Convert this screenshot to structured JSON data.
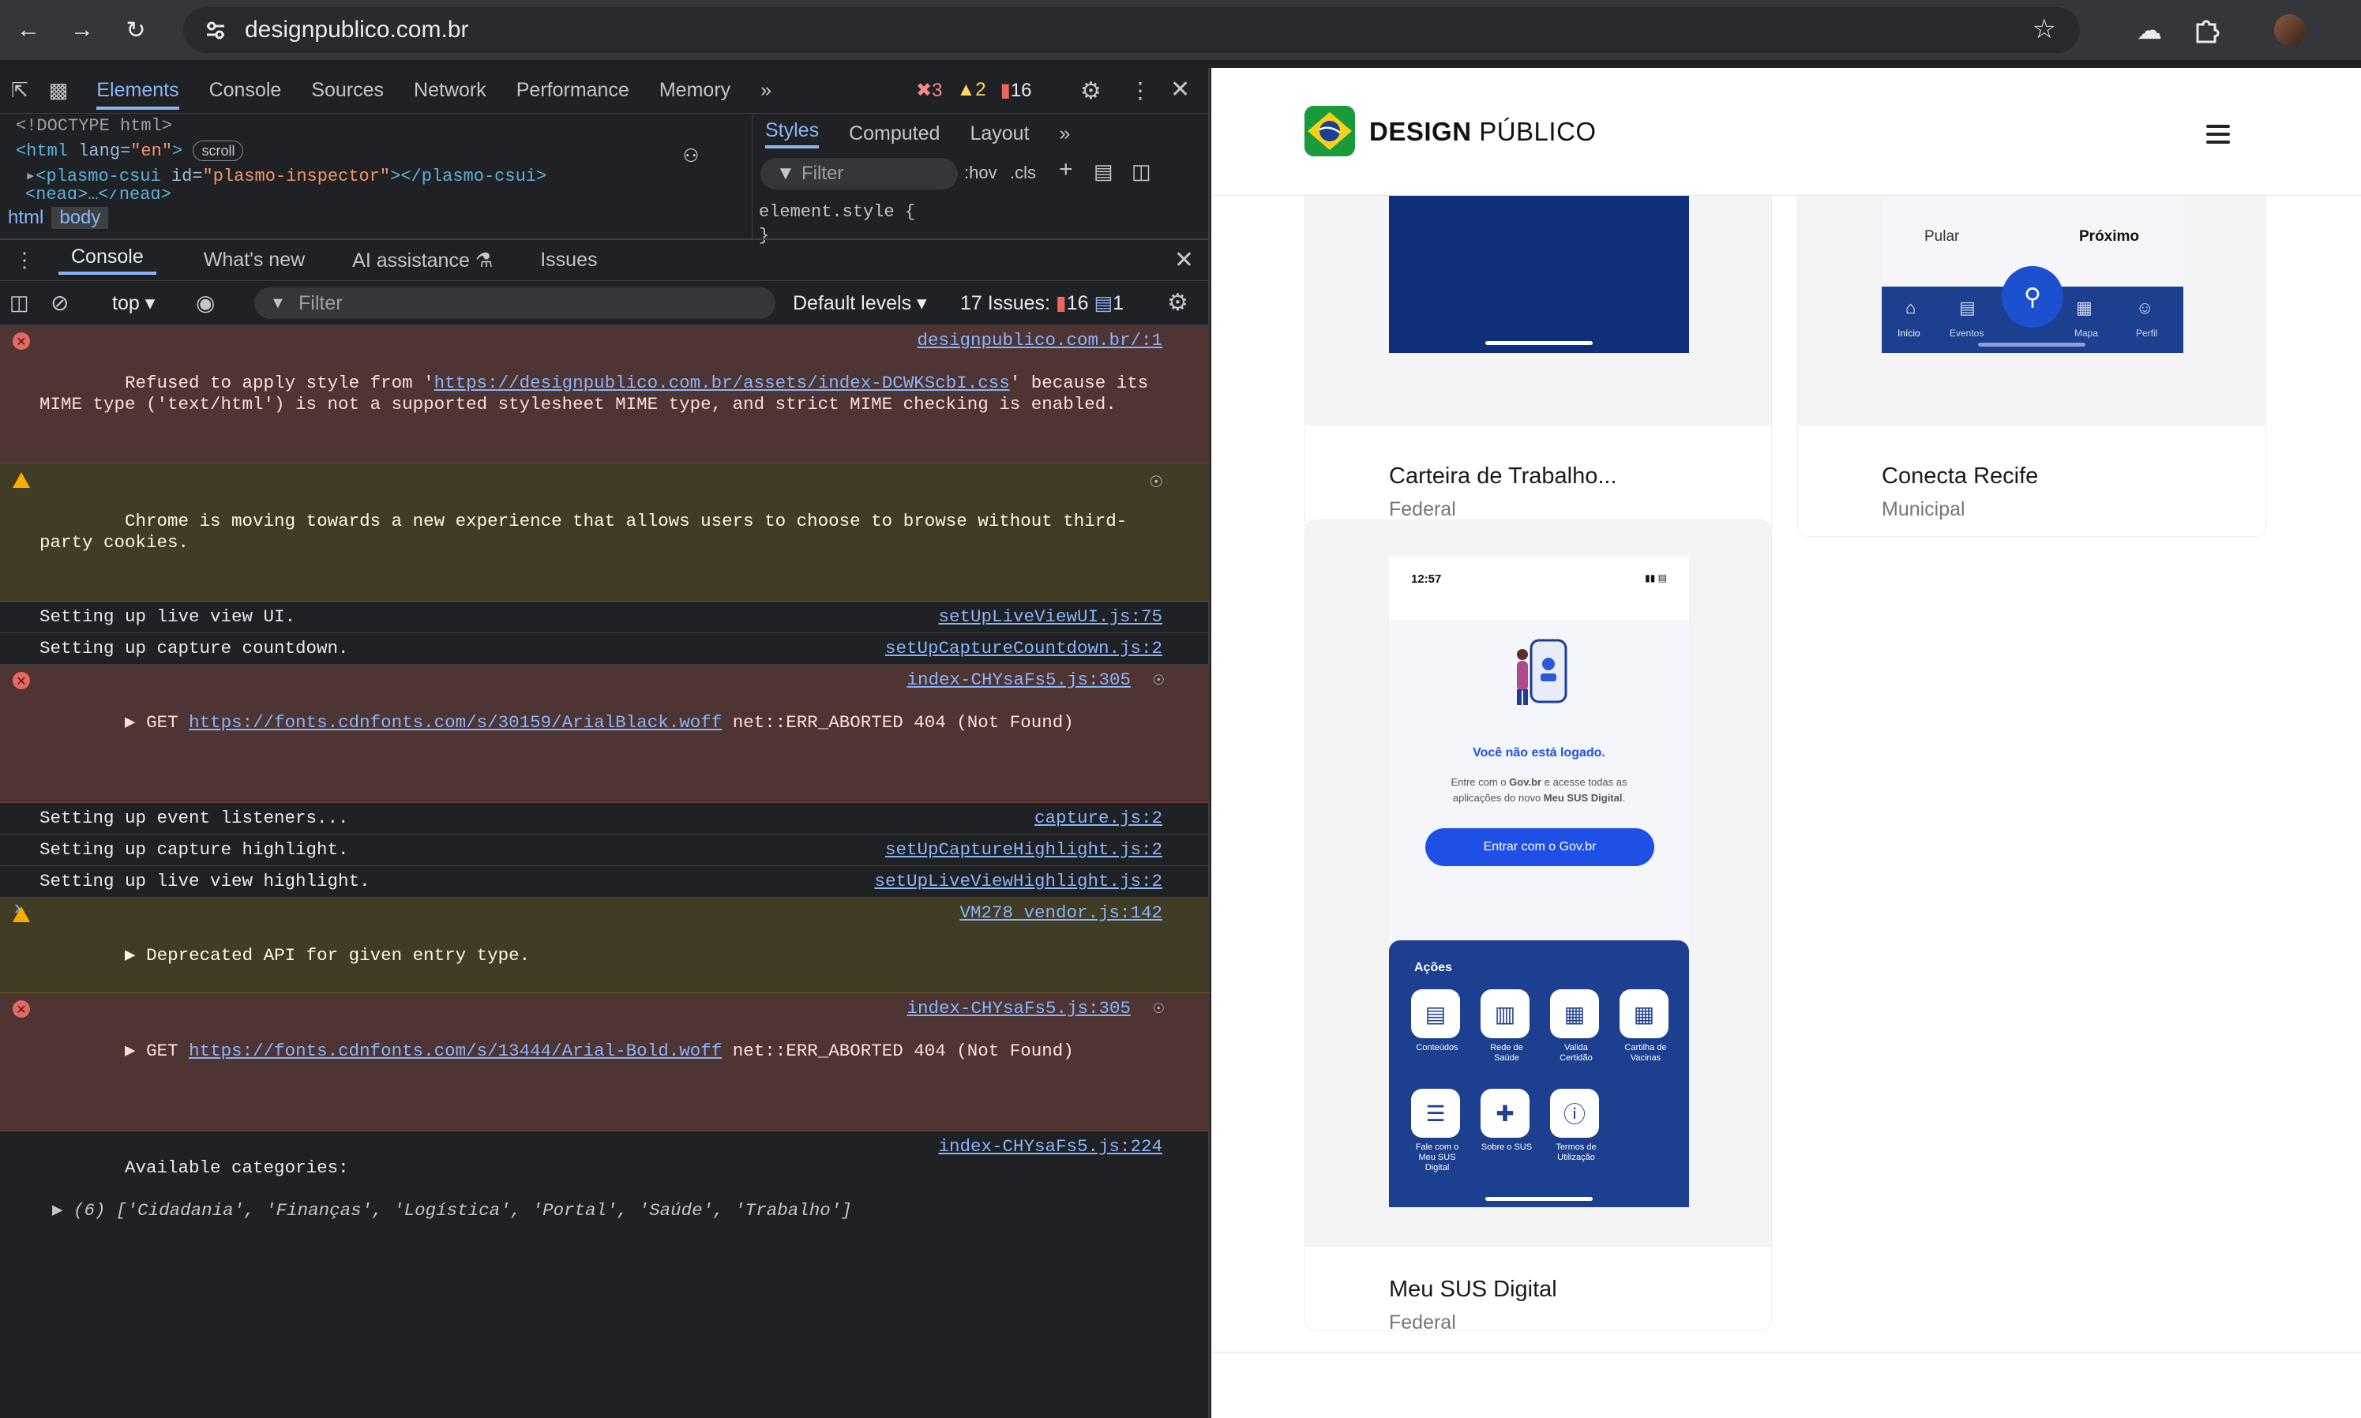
{
  "browser": {
    "url": "designpublico.com.br",
    "back_icon": "arrow-left-icon",
    "forward_icon": "arrow-right-icon",
    "reload_icon": "reload-icon"
  },
  "devtools": {
    "tabs": [
      "Elements",
      "Console",
      "Sources",
      "Network",
      "Performance",
      "Memory"
    ],
    "more": "»",
    "counts": {
      "errors": "3",
      "warnings": "2",
      "issues": "16"
    },
    "elements": {
      "doctype": "<!DOCTYPE html>",
      "html_open": "<html",
      "html_attr": " lang=",
      "html_val": "\"en\"",
      "html_close": ">",
      "scroll": "scroll",
      "csui_open": "<plasmo-csui",
      "csui_attr": " id=",
      "csui_val": "\"plasmo-inspector\"",
      "csui_close": "></plasmo-csui>",
      "head": "<head>…</head>"
    },
    "crumbs": [
      "html",
      "body"
    ],
    "styles": {
      "tabs": [
        "Styles",
        "Computed",
        "Layout"
      ],
      "filter": "Filter",
      "hov": ":hov",
      "cls": ".cls",
      "rule_open": "element.style {",
      "rule_close": "}"
    },
    "drawer": {
      "tabs": [
        "Console",
        "What's new",
        "AI assistance",
        "Issues"
      ],
      "context": "top",
      "filter": "Filter",
      "levels": "Default levels",
      "issues_label": "17 Issues:",
      "issues_warn": "16",
      "issues_info": "1"
    },
    "messages": [
      {
        "type": "err",
        "pre": "Refused to apply style from '",
        "link": "https://designpublico.com.br/assets/index-DCWKScbI.css",
        "post": "' because its MIME type ('text/html') is not a supported stylesheet MIME type, and strict MIME checking is enabled.",
        "src": "designpublico.com.br/:1"
      },
      {
        "type": "warn",
        "text": "Chrome is moving towards a new experience that allows users to choose to browse without third-party cookies."
      },
      {
        "type": "log",
        "text": "Setting up live view UI.",
        "src": "setUpLiveViewUI.js:75"
      },
      {
        "type": "log",
        "text": "Setting up capture countdown.",
        "src": "setUpCaptureCountdown.js:2"
      },
      {
        "type": "err",
        "pre": "▶ GET ",
        "link": "https://fonts.cdnfonts.com/s/30159/ArialBlack.woff",
        "post": " net::ERR_ABORTED 404 (Not Found)",
        "src": "index-CHYsaFs5.js:305"
      },
      {
        "type": "log",
        "text": "Setting up event listeners...",
        "src": "capture.js:2"
      },
      {
        "type": "log",
        "text": "Setting up capture highlight.",
        "src": "setUpCaptureHighlight.js:2"
      },
      {
        "type": "log",
        "text": "Setting up live view highlight.",
        "src": "setUpLiveViewHighlight.js:2"
      },
      {
        "type": "warn",
        "text": "▶ Deprecated API for given entry type.",
        "src": "VM278 vendor.js:142"
      },
      {
        "type": "err",
        "pre": "▶ GET ",
        "link": "https://fonts.cdnfonts.com/s/13444/Arial-Bold.woff",
        "post": " net::ERR_ABORTED 404 (Not Found)",
        "src": "index-CHYsaFs5.js:305"
      },
      {
        "type": "log",
        "text": "Available categories:",
        "src": "index-CHYsaFs5.js:224",
        "extra": "▶ (6) ['Cidadania', 'Finanças', 'Logística', 'Portal', 'Saúde', 'Trabalho']"
      }
    ],
    "prompt": "›"
  },
  "site": {
    "brand_bold": "DESIGN",
    "brand_rest": " PÚBLICO",
    "cards": [
      {
        "title": "Carteira de Trabalho...",
        "sub": "Federal"
      },
      {
        "title": "Conecta Recife",
        "sub": "Municipal",
        "skip": "Pular",
        "next": "Próximo",
        "nav": [
          "Início",
          "Eventos",
          "",
          "Mapa",
          "Perfil"
        ]
      },
      {
        "title": "Meu SUS Digital",
        "sub": "Federal"
      }
    ],
    "sus": {
      "time": "12:57",
      "not_logged": "Você não está logado.",
      "desc_a": "Entre com o ",
      "desc_b": "Gov.br",
      "desc_c": " e acesse todas as aplicações do novo ",
      "desc_d": "Meu SUS Digital",
      "desc_e": ".",
      "btn": "Entrar com o Gov.br",
      "actions_title": "Ações",
      "actions": [
        "Conteúdos",
        "Rede de Saúde",
        "Valida Certidão",
        "Cartilha de Vacinas",
        "Fale com o Meu SUS Digital",
        "Sobre o SUS",
        "Termos de Utilização"
      ]
    }
  },
  "colors": {
    "accent": "#8ab4f8",
    "gov_blue": "#1d3f8f",
    "button_blue": "#1e50e6"
  }
}
